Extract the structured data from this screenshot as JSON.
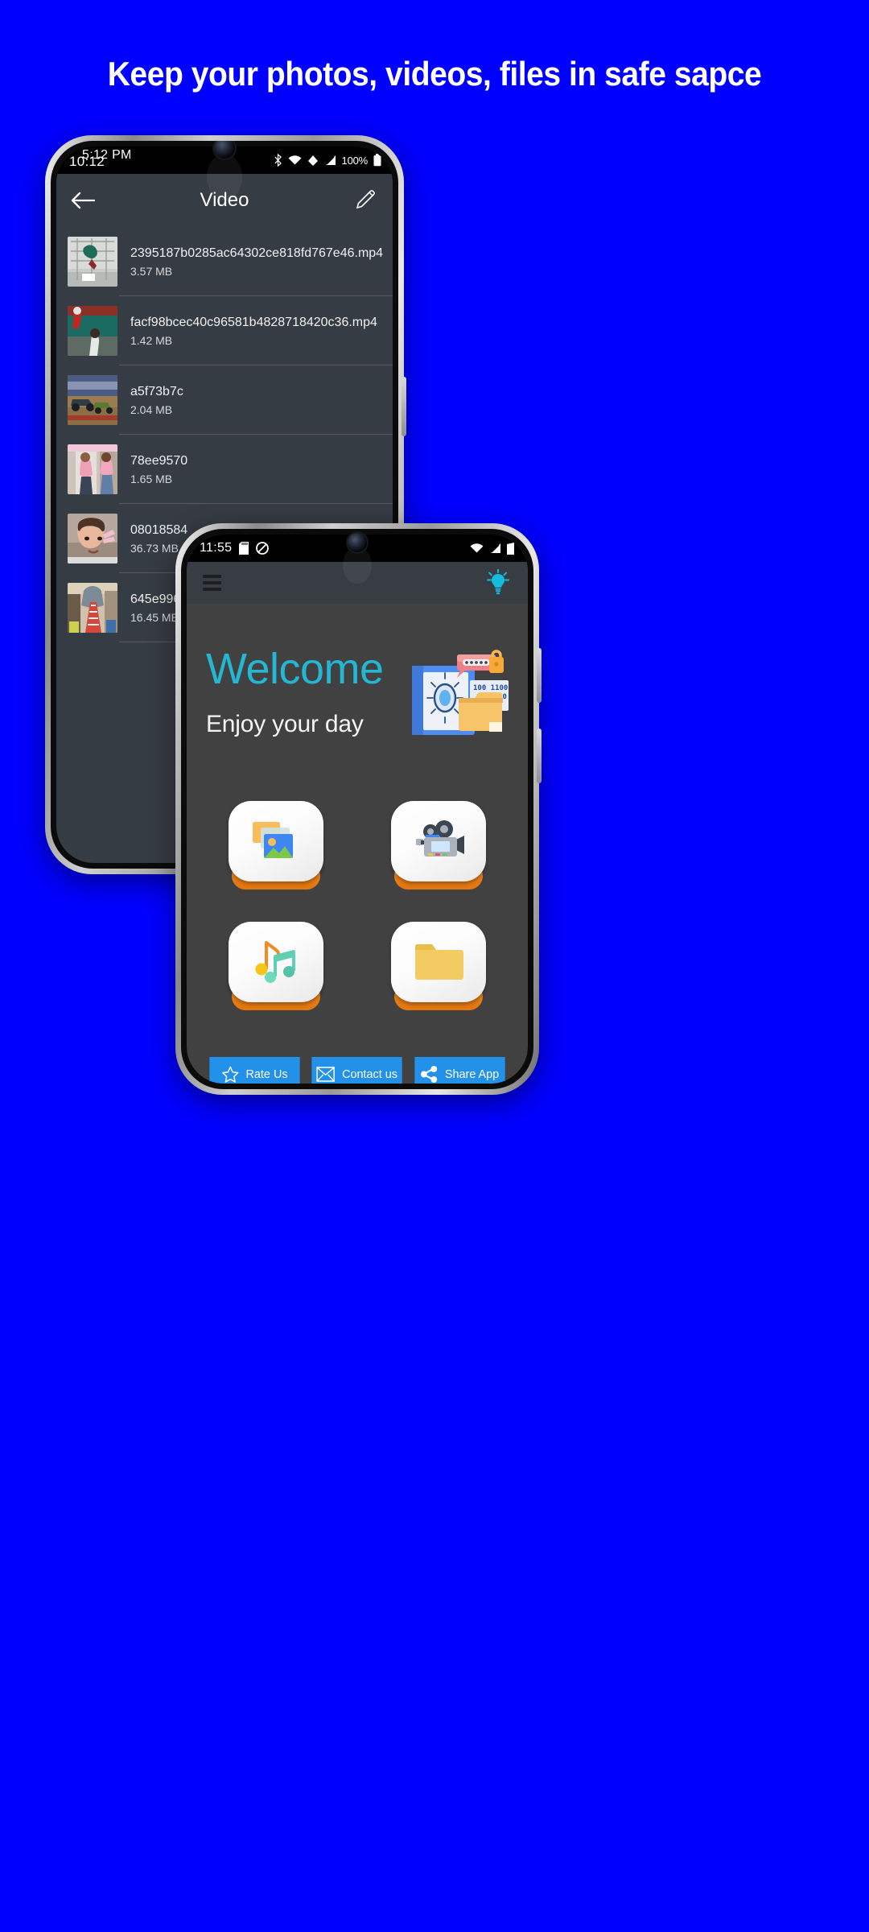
{
  "headline": "Keep your photos, videos, files in safe sapce",
  "background_color": "#0000ff",
  "back_phone": {
    "status_bar": {
      "clock_primary": "10:12",
      "clock_secondary": "5:12 PM",
      "battery_percent": "100%",
      "icons": [
        "bluetooth-icon",
        "wifi-icon",
        "vibrate-icon",
        "signal-icon",
        "battery-icon"
      ]
    },
    "appbar": {
      "back_icon": "arrow-left-icon",
      "title": "Video",
      "edit_icon": "pencil-icon"
    },
    "files": [
      {
        "name": "2395187b0285ac64302ce818fd767e46.mp4",
        "size": "3.57 MB"
      },
      {
        "name": "facf98bcec40c96581b4828718420c36.mp4",
        "size": "1.42 MB"
      },
      {
        "name": "a5f73b7c",
        "size": "2.04 MB"
      },
      {
        "name": "78ee9570",
        "size": "1.65 MB"
      },
      {
        "name": "08018584",
        "size": "36.73 MB"
      },
      {
        "name": "645e996f",
        "size": "16.45 MB"
      }
    ]
  },
  "front_phone": {
    "status_bar": {
      "clock": "11:55",
      "icons": [
        "sd-card-icon",
        "mute-icon",
        "wifi-icon",
        "signal-icon",
        "battery-icon"
      ]
    },
    "appbar": {
      "menu_icon": "hamburger-menu-icon",
      "flashlight_icon": "lightbulb-icon",
      "flashlight_color": "#15bcdc"
    },
    "hero": {
      "welcome": "Welcome",
      "welcome_color": "#23b7d3",
      "subtitle": "Enjoy your day",
      "illustration": "vault-lock-folder-illustration",
      "binary_lines": [
        "100 1100",
        "0110 10",
        "1 01"
      ]
    },
    "tiles": [
      {
        "icon": "photos-icon",
        "name": "photos-tile"
      },
      {
        "icon": "video-camera-icon",
        "name": "videos-tile"
      },
      {
        "icon": "music-note-icon",
        "name": "audio-tile"
      },
      {
        "icon": "folder-icon",
        "name": "files-tile"
      }
    ],
    "actions": [
      {
        "label": "Rate Us",
        "icon": "star-icon"
      },
      {
        "label": "Contact us",
        "icon": "envelope-icon"
      },
      {
        "label": "Share App",
        "icon": "share-icon"
      }
    ],
    "accent_button_color": "#2390ea"
  }
}
